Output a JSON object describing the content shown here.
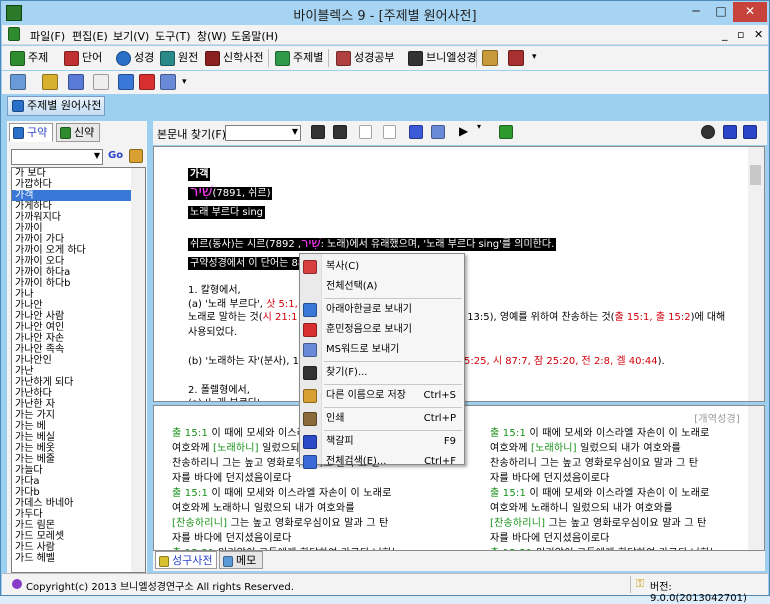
{
  "window": {
    "title": "바이블렉스 9 - [주제별 원어사전]",
    "min_glyph": "─",
    "max_glyph": "□",
    "close_glyph": "✕",
    "mdi_controls": "_ ▫ ✕"
  },
  "menu": [
    "파일(F)",
    "편집(E)",
    "보기(V)",
    "도구(T)",
    "창(W)",
    "도움말(H)"
  ],
  "toolbar1": [
    {
      "label": "주제",
      "icon": "green-book-icon",
      "color": "#2e8b2e"
    },
    {
      "label": "단어",
      "icon": "red-book-icon",
      "color": "#c03030"
    },
    {
      "label": "성경",
      "icon": "blue-globe-icon",
      "color": "#2a6fc8"
    },
    {
      "label": "원전",
      "icon": "teal-book-icon",
      "color": "#2a8a8a"
    },
    {
      "label": "신학사전",
      "icon": "dark-red-book-icon",
      "color": "#8a2020"
    },
    {
      "label": "주제별",
      "icon": "green-bookmark-icon",
      "color": "#2f9a4a"
    },
    {
      "label": "성경공부",
      "icon": "red-books-icon",
      "color": "#b04040"
    },
    {
      "label": "브니엘성경",
      "icon": "black-book-icon",
      "color": "#333333"
    }
  ],
  "doc_tab": "주제별 원어사전",
  "left_panel": {
    "tab_ot": "구약",
    "tab_nt": "신약",
    "go_label": "Go",
    "selected_index": 2,
    "words": [
      "가 보다",
      "가깝하다",
      "가객",
      "가게하다",
      "가까워지다",
      "가까이",
      "가까이 가다",
      "가까이 오게 하다",
      "가까이 오다",
      "가까이 하다a",
      "가까이 하다b",
      "가나",
      "가나안",
      "가나안 사람",
      "가나안 여인",
      "가나안 자손",
      "가나안 족속",
      "가나안인",
      "가난",
      "가난하게 되다",
      "가난하다",
      "가난한 자",
      "가는 가지",
      "가는 베",
      "가는 베실",
      "가는 베옷",
      "가는 베줄",
      "가늘다",
      "가다a",
      "가다b",
      "가데스 바네아",
      "가두다",
      "가드 림몬",
      "가드 모레셋",
      "가드 사람",
      "가드 헤벨"
    ]
  },
  "find": {
    "label": "본문내 찾기(F):"
  },
  "content": {
    "heading": "가객",
    "hebrew": "שִׁיר",
    "strongs": "(7891, 쉬르)",
    "gloss": "노래 부르다 sing",
    "para1a": "쉬르(동사)는 시르(",
    "para1_hebrew": "שִׁיר",
    "para1b": ", 7892: 노래)에서 유래했으며, '노래 부르다 sing'를 의미한다.",
    "para2": "구약성경에서 이 단어는 88",
    "sec1": "1. 칼형에서,",
    "sec1a_pre": "(a) '노래 부르다',",
    "sec1a_refs": "삿 5:1, 시",
    "sec1b_pre": "노래로 말하는 것(",
    "sec1b_ref1": "시 21:1",
    "sec1b_mid": "13:5), 영예를 위하여 찬송하는 것(",
    "sec1b_ref2": "출 15:1, 출 15:2",
    "sec1b_post": ")에 대해",
    "sec1c": "사용되었다.",
    "sec1d_pre": "(b) '노래하는 자'(분사), 1",
    "sec1d_refs": "5:25, 시 87:7, 잠 25:20, 전 2:8, 겔 40:44",
    "sec1d_post": ").",
    "sec2": "2. 폴렐형에서,",
    "sec2a": "(a) '노래 부르다'"
  },
  "bottom": {
    "label": "[개역성경]",
    "col1": [
      {
        "ref": "출 15:1",
        "pre": "이 때에 모세와 이스라엘 자손이 이 노래로",
        "kw": "",
        "post": ""
      },
      {
        "ref": "",
        "pre": "여호와께 ",
        "kw": "[노래하니]",
        "post": " 일렀으되 내가 여호와를"
      },
      {
        "ref": "",
        "pre": "찬송하리니 그는 높고 영화로우심이요 말과 그 탄",
        "kw": "",
        "post": ""
      },
      {
        "ref": "",
        "pre": "자를 바다에 던지셨음이로다",
        "kw": "",
        "post": ""
      },
      {
        "ref": "출 15:1",
        "pre": "이 때에 모세와 이스라엘 자손이 이 노래로",
        "kw": "",
        "post": ""
      },
      {
        "ref": "",
        "pre": "여호와께 노래하니 일렀으되 내가 여호와를",
        "kw": "",
        "post": ""
      },
      {
        "ref": "",
        "pre": "",
        "kw": "[찬송하리니]",
        "post": " 그는 높고 영화로우심이요 말과 그 탄"
      },
      {
        "ref": "",
        "pre": "자를 바다에 던지셨음이로다",
        "kw": "",
        "post": ""
      },
      {
        "ref": "출 15:21",
        "pre": "미리암이 그들에게 화답하여 가로되 너희는",
        "kw": "",
        "post": ""
      }
    ],
    "col2": [
      {
        "ref": "출 15:1",
        "pre": "이 때에 모세와 이스라엘 자손이 이 노래로",
        "kw": "",
        "post": ""
      },
      {
        "ref": "",
        "pre": "여호와께 ",
        "kw": "[노래하니]",
        "post": " 일렀으되 내가 여호와를"
      },
      {
        "ref": "",
        "pre": "찬송하리니 그는 높고 영화로우심이요 말과 그 탄",
        "kw": "",
        "post": ""
      },
      {
        "ref": "",
        "pre": "자를 바다에 던지셨음이로다",
        "kw": "",
        "post": ""
      },
      {
        "ref": "출 15:1",
        "pre": "이 때에 모세와 이스라엘 자손이 이 노래로",
        "kw": "",
        "post": ""
      },
      {
        "ref": "",
        "pre": "여호와께 노래하니 일렀으되 내가 여호와를",
        "kw": "",
        "post": ""
      },
      {
        "ref": "",
        "pre": "",
        "kw": "[찬송하리니]",
        "post": " 그는 높고 영화로우심이요 말과 그 탄"
      },
      {
        "ref": "",
        "pre": "자를 바다에 던지셨음이로다",
        "kw": "",
        "post": ""
      },
      {
        "ref": "출 15:21",
        "pre": "미리암이 그들에게 화답하여 가로되 너희는",
        "kw": "",
        "post": ""
      }
    ]
  },
  "bottom_tabs": {
    "tab1": "성구사전",
    "tab2": "메모"
  },
  "context_menu": [
    {
      "label": "복사(C)",
      "shortcut": "",
      "icon": "copy-icon",
      "color": "#d84040"
    },
    {
      "label": "전체선택(A)",
      "shortcut": "",
      "icon": "",
      "color": ""
    },
    {
      "sep": true
    },
    {
      "label": "아래아한글로 보내기",
      "shortcut": "",
      "icon": "hangul-icon",
      "color": "#3a78d8"
    },
    {
      "label": "훈민정음으로 보내기",
      "shortcut": "",
      "icon": "hunmin-icon",
      "color": "#d83030"
    },
    {
      "label": "MS워드로 보내기",
      "shortcut": "",
      "icon": "word-icon",
      "color": "#6a8ad8"
    },
    {
      "sep": true
    },
    {
      "label": "찾기(F)...",
      "shortcut": "",
      "icon": "binoculars-icon",
      "color": "#333333"
    },
    {
      "sep": true
    },
    {
      "label": "다른 이름으로 저장",
      "shortcut": "Ctrl+S",
      "icon": "save-icon",
      "color": "#d8a030"
    },
    {
      "sep": true
    },
    {
      "label": "인쇄",
      "shortcut": "Ctrl+P",
      "icon": "print-icon",
      "color": "#8a6a3a"
    },
    {
      "sep": true
    },
    {
      "label": "책갈피",
      "shortcut": "F9",
      "icon": "bookmark-icon",
      "color": "#2a4ac8"
    },
    {
      "label": "전체검색(E)...",
      "shortcut": "Ctrl+F",
      "icon": "search-icon",
      "color": "#3a6ad8"
    }
  ],
  "status": {
    "copyright": "Copyright(c) 2013 브니엘성경연구소 All rights Reserved.",
    "version": "버전: 9.0.0(2013042701)"
  }
}
